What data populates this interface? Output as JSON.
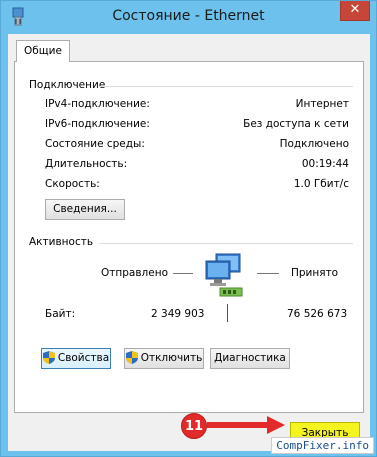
{
  "window": {
    "title": "Состояние - Ethernet",
    "close_glyph": "✕"
  },
  "tabs": [
    {
      "label": "Общие"
    }
  ],
  "connection": {
    "header": "Подключение",
    "rows": [
      {
        "label": "IPv4-подключение:",
        "value": "Интернет"
      },
      {
        "label": "IPv6-подключение:",
        "value": "Без доступа к сети"
      },
      {
        "label": "Состояние среды:",
        "value": "Подключено"
      },
      {
        "label": "Длительность:",
        "value": "00:19:44"
      },
      {
        "label": "Скорость:",
        "value": "1.0 Гбит/с"
      }
    ],
    "details_button": "Сведения..."
  },
  "activity": {
    "header": "Активность",
    "sent_label": "Отправлено",
    "received_label": "Принято",
    "bytes_label": "Байт:",
    "bytes_sent": "2 349 903",
    "bytes_received": "76 526 673"
  },
  "buttons": {
    "properties": "Свойства",
    "disable": "Отключить",
    "diagnostics": "Диагностика",
    "close": "Закрыть"
  },
  "annotation": {
    "step_number": "11"
  },
  "watermark": "CompFixer.info",
  "colors": {
    "frame": "#6cc2ec",
    "close_button": "#c7463a",
    "highlight": "#f4f41e",
    "marker": "#e32a2a"
  }
}
